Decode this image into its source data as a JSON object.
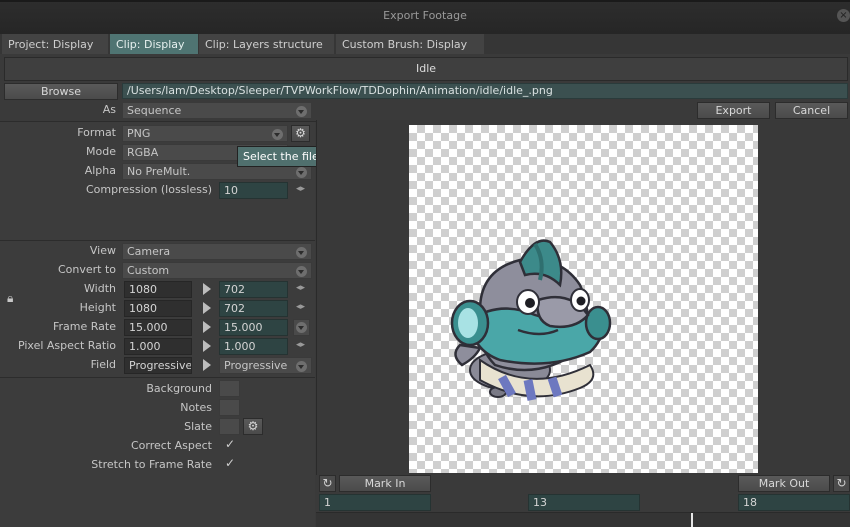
{
  "window": {
    "title": "Export Footage"
  },
  "tabs": [
    "Project: Display",
    "Clip: Display",
    "Clip: Layers structure",
    "Custom Brush: Display"
  ],
  "clip_name": "Idle",
  "browse": {
    "button": "Browse",
    "path": "/Users/lam/Desktop/Sleeper/TVPWorkFlow/TDDophin/Animation/idle/idle_.png"
  },
  "as": {
    "label": "As",
    "value": "Sequence"
  },
  "actions": {
    "export": "Export",
    "cancel": "Cancel"
  },
  "format": {
    "label": "Format",
    "value": "PNG"
  },
  "mode": {
    "label": "Mode",
    "value": "RGBA"
  },
  "alpha": {
    "label": "Alpha",
    "value": "No PreMult."
  },
  "compression": {
    "label": "Compression (lossless)",
    "value": "10"
  },
  "tooltip": "Select the file format used for the exported footage",
  "view": {
    "label": "View",
    "value": "Camera"
  },
  "convert_to": {
    "label": "Convert to",
    "value": "Custom"
  },
  "width": {
    "label": "Width",
    "source": "1080",
    "target": "702"
  },
  "height": {
    "label": "Height",
    "source": "1080",
    "target": "702"
  },
  "frame_rate": {
    "label": "Frame Rate",
    "source": "15.000",
    "target": "15.000"
  },
  "pixel_aspect": {
    "label": "Pixel Aspect Ratio",
    "source": "1.000",
    "target": "1.000"
  },
  "field": {
    "label": "Field",
    "source": "Progressive",
    "target": "Progressive"
  },
  "options": {
    "background": "Background",
    "notes": "Notes",
    "slate": "Slate",
    "correct_aspect": "Correct Aspect",
    "stretch": "Stretch to Frame Rate"
  },
  "checks": {
    "correct_aspect": true,
    "stretch": true
  },
  "timeline": {
    "mark_in": "Mark In",
    "mark_out": "Mark Out",
    "in_value": "1",
    "current_value": "13",
    "out_value": "18"
  },
  "colors": {
    "accent": "#4f7472",
    "tooltip_bg": "#50706e",
    "path_bg": "#3b5050"
  }
}
